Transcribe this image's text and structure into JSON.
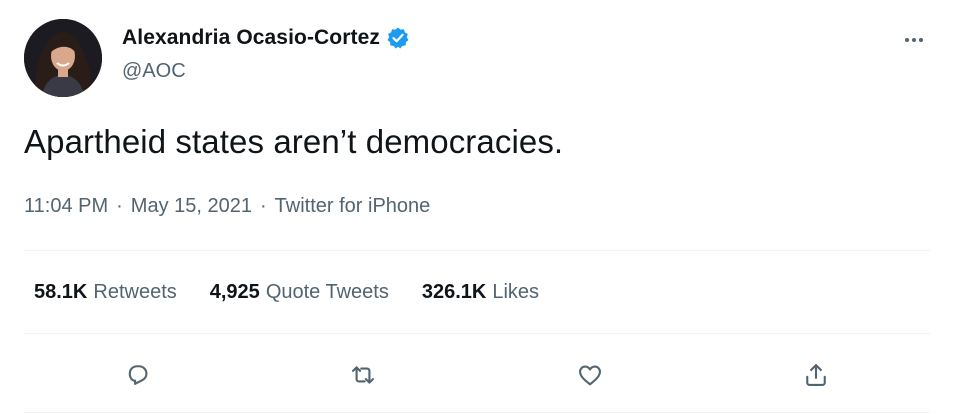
{
  "author": {
    "display_name": "Alexandria Ocasio-Cortez",
    "handle": "@AOC",
    "verified": true,
    "verified_color": "#1d9bf0"
  },
  "tweet": {
    "text": "Apartheid states aren’t democracies.",
    "time": "11:04 PM",
    "separator": "·",
    "date": "May 15, 2021",
    "source": "Twitter for iPhone"
  },
  "stats": [
    {
      "value": "58.1K",
      "label": "Retweets"
    },
    {
      "value": "4,925",
      "label": "Quote Tweets"
    },
    {
      "value": "326.1K",
      "label": "Likes"
    }
  ],
  "actions": [
    {
      "icon": "reply-icon"
    },
    {
      "icon": "retweet-icon"
    },
    {
      "icon": "like-icon"
    },
    {
      "icon": "share-icon"
    }
  ],
  "colors": {
    "text_primary": "#0f1419",
    "text_secondary": "#536471",
    "divider": "#eff3f4",
    "brand": "#1d9bf0"
  }
}
